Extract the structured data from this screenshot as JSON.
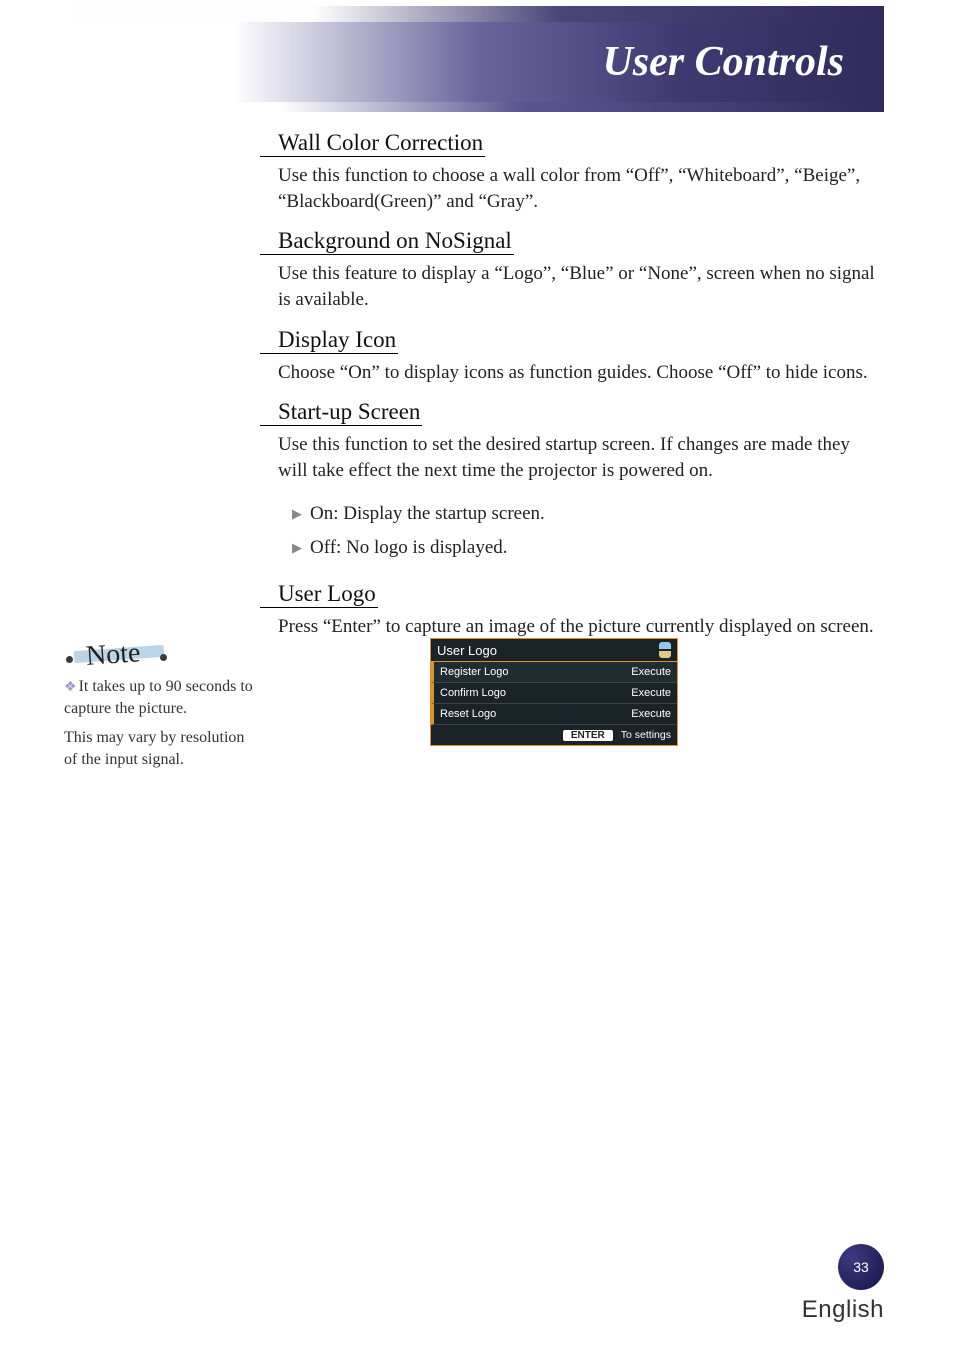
{
  "header": {
    "title": "User Controls"
  },
  "sections": {
    "wall_color": {
      "heading": "Wall Color Correction",
      "body": "Use this function to choose a wall color from “Off”, “Whiteboard”, “Beige”, “Blackboard(Green)” and “Gray”."
    },
    "bg_nosignal": {
      "heading": "Background on NoSignal",
      "body": "Use this feature to display a “Logo”, “Blue” or “None”, screen when no signal is available."
    },
    "display_icon": {
      "heading": "Display Icon",
      "body": "Choose “On” to display icons as function guides. Choose “Off” to hide icons."
    },
    "startup": {
      "heading": "Start-up Screen",
      "body": "Use this function to set the desired startup screen. If changes are made they will take effect the next time the projector is powered on.",
      "bullets": [
        "On: Display the startup screen.",
        "Off: No logo is displayed."
      ]
    },
    "user_logo": {
      "heading": "User Logo",
      "body": "Press “Enter” to capture an image of the picture currently displayed on screen."
    }
  },
  "side_note": {
    "label": "Note",
    "line1": "It takes up to 90 seconds to capture the picture.",
    "line2": "This may vary by resolution of the input signal."
  },
  "osd": {
    "title": "User Logo",
    "rows": [
      {
        "label": "Register Logo",
        "value": "Execute"
      },
      {
        "label": "Confirm Logo",
        "value": "Execute"
      },
      {
        "label": "Reset Logo",
        "value": "Execute"
      }
    ],
    "footer_key": "ENTER",
    "footer_text": "To settings"
  },
  "footer": {
    "page_number": "33",
    "language": "English"
  }
}
